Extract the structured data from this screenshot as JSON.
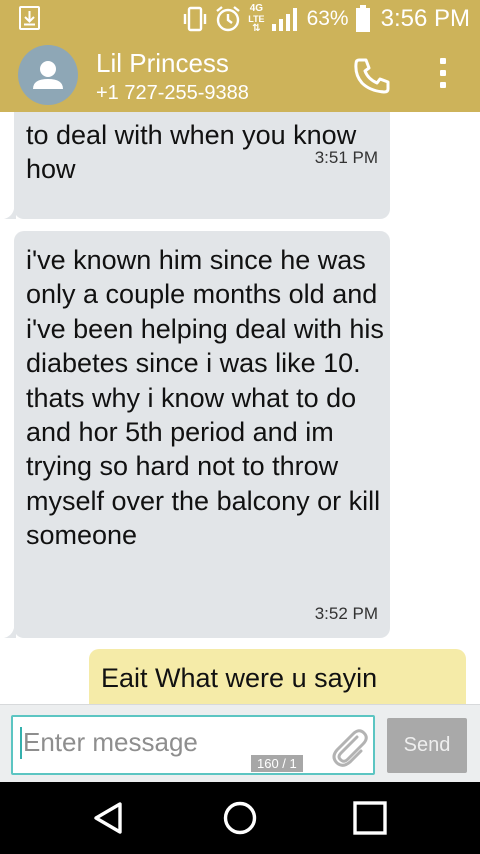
{
  "status_bar": {
    "network": "4G LTE",
    "battery": "63%",
    "time": "3:56 PM",
    "icons": [
      "download-icon",
      "vibrate-icon",
      "alarm-icon",
      "signal-icon",
      "battery-icon"
    ]
  },
  "contact": {
    "name": "Lil Princess",
    "number": "+1 727-255-9388"
  },
  "messages": [
    {
      "direction": "received",
      "text": "to deal with when you know how",
      "time": "3:51 PM"
    },
    {
      "direction": "received",
      "text": "i've known him since he was only a couple months old and i've been helping deal with his diabetes since i was like 10. thats why i know what to do and hor 5th period and im trying so hard not to throw myself over the balcony or kill someone",
      "time": "3:52 PM"
    },
    {
      "direction": "sent",
      "text": "Eait What were u sayin"
    }
  ],
  "composer": {
    "placeholder": "Enter message",
    "counter": "160 / 1",
    "send_label": "Send"
  },
  "colors": {
    "header": "#cdb35a",
    "received_bubble": "#e2e5e8",
    "sent_bubble": "#f5eba8",
    "input_border": "#5cc5c2"
  }
}
